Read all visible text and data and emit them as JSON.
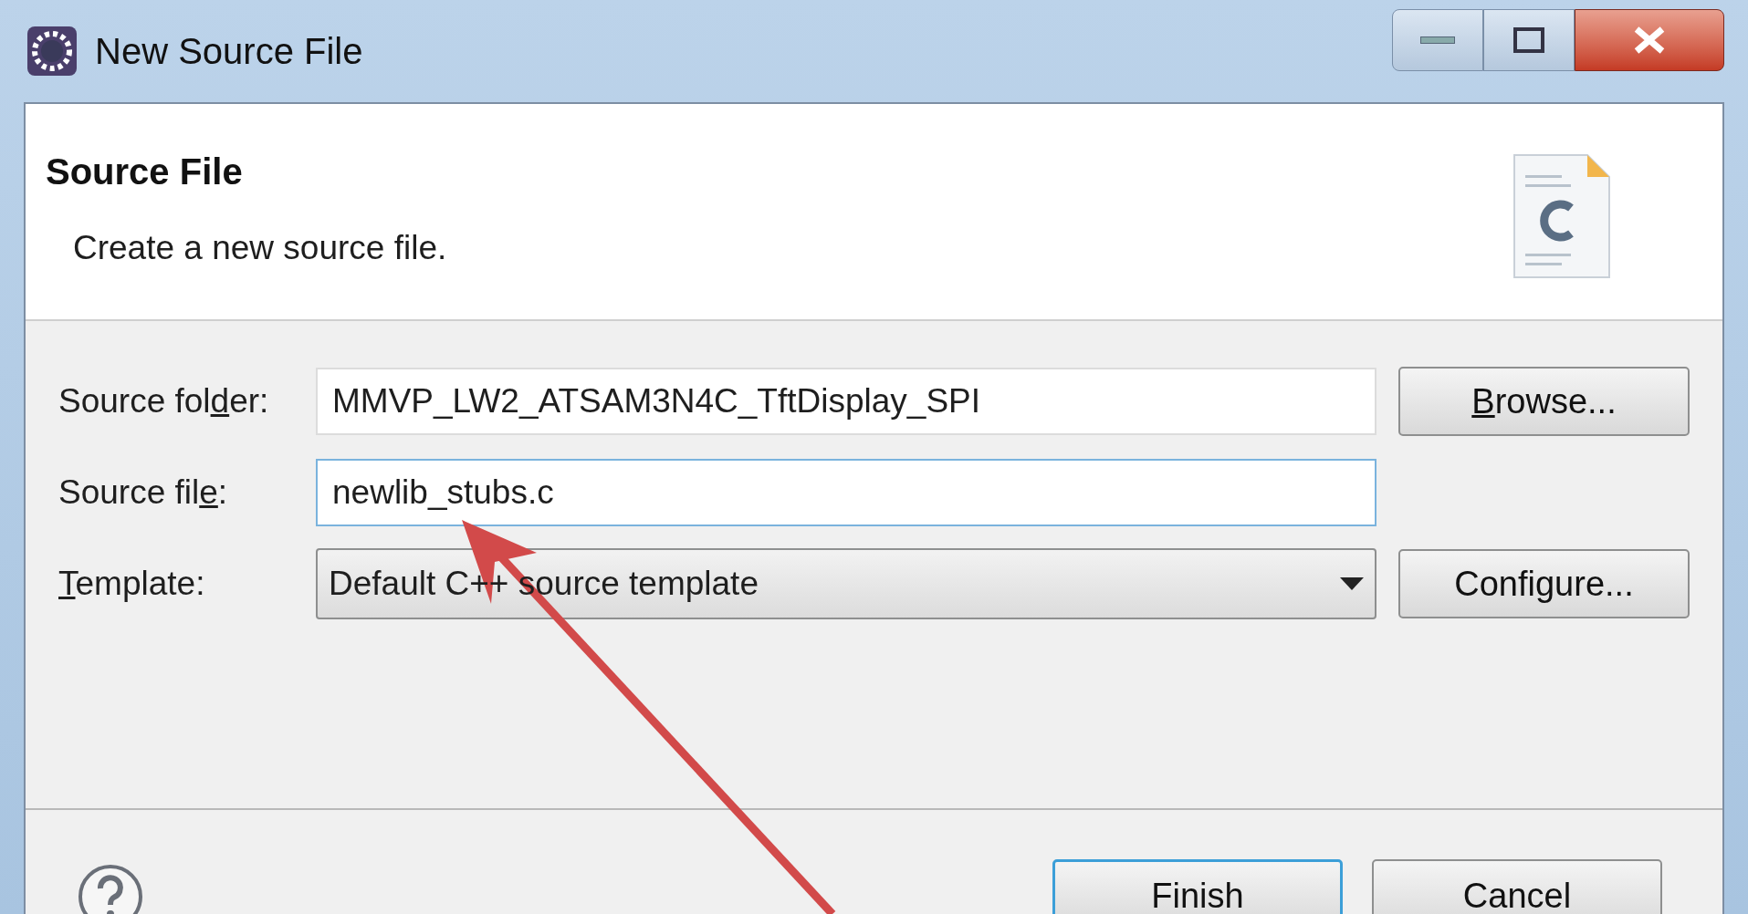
{
  "window": {
    "title": "New Source File"
  },
  "header": {
    "title": "Source File",
    "description": "Create a new source file."
  },
  "fields": [
    {
      "kind": "text",
      "label": {
        "before": "Source fol",
        "mnemonic": "d",
        "after": "er:"
      },
      "value": "MMVP_LW2_ATSAM3N4C_TftDisplay_SPI",
      "focused": false,
      "button": {
        "mnemonic": "B",
        "after": "rowse..."
      }
    },
    {
      "kind": "text",
      "label": {
        "before": "Source fil",
        "mnemonic": "e",
        "after": ":"
      },
      "value": "newlib_stubs.c",
      "focused": true
    },
    {
      "kind": "dropdown",
      "label": {
        "mnemonic": "T",
        "after": "emplate:"
      },
      "value": "Default C++ source template",
      "button": {
        "before": "Configure..."
      }
    }
  ],
  "buttons": [
    {
      "label": "Finish",
      "default": true
    },
    {
      "label": "Cancel",
      "default": false
    }
  ]
}
